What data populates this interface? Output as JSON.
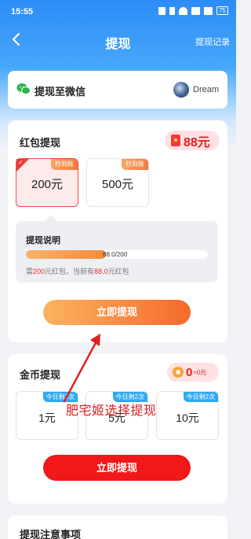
{
  "status_bar": {
    "time": "15:55",
    "battery": "75"
  },
  "nav": {
    "title": "提现",
    "right_link": "提现记录"
  },
  "wechat": {
    "label": "提现至微信",
    "user_name": "Dream"
  },
  "red_packet": {
    "title": "红包提现",
    "balance": "88元",
    "options": [
      {
        "tag": "秒到账",
        "value": "200元",
        "selected": true
      },
      {
        "tag": "秒到账",
        "value": "500元",
        "selected": false
      }
    ],
    "explain": {
      "title": "提现说明",
      "progress_text": "88.0/200",
      "progress": 0.44,
      "note_prefix": "需",
      "note_need": "200",
      "note_mid": "元红包，当前有",
      "note_have": "88.0",
      "note_suffix": "元红包"
    },
    "button": "立即提现"
  },
  "gold": {
    "title": "金币提现",
    "balance": "0",
    "balance_sub": "≈0元",
    "options": [
      {
        "tag": "今日剩3次",
        "value": "1元"
      },
      {
        "tag": "今日剩2次",
        "value": "5元"
      },
      {
        "tag": "今日剩2次",
        "value": "10元"
      }
    ],
    "button": "立即提现"
  },
  "notes": {
    "title": "提现注意事项"
  },
  "annotation": {
    "text": "肥宅姬选择提现"
  },
  "colors": {
    "accent_blue": "#2d8cf7",
    "red": "#f01818",
    "orange": "#f46a2a"
  }
}
